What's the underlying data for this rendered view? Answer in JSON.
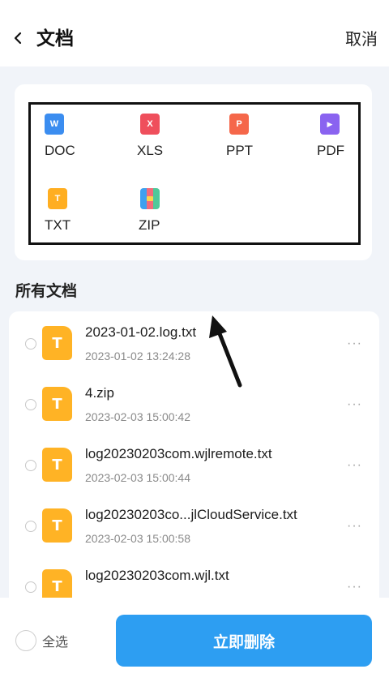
{
  "header": {
    "title": "文档",
    "cancel_label": "取消"
  },
  "categories": [
    {
      "label": "DOC",
      "icon": "word-doc-icon",
      "glyph": "W",
      "color": "#3b8df0"
    },
    {
      "label": "XLS",
      "icon": "excel-xls-icon",
      "glyph": "X",
      "color": "#ef4f5c"
    },
    {
      "label": "PPT",
      "icon": "ppt-icon",
      "glyph": "P",
      "color": "#f5674a"
    },
    {
      "label": "PDF",
      "icon": "pdf-icon",
      "glyph": "▶",
      "color": "#8a63f0"
    },
    {
      "label": "TXT",
      "icon": "txt-icon",
      "glyph": "T",
      "color": "#ffae21"
    },
    {
      "label": "ZIP",
      "icon": "zip-icon",
      "glyph": "",
      "color": "#f36a7a"
    }
  ],
  "section_title": "所有文档",
  "files": [
    {
      "name": "2023-01-02.log.txt",
      "date": "2023-01-02 13:24:28"
    },
    {
      "name": "4.zip",
      "date": "2023-02-03 15:00:42"
    },
    {
      "name": "log20230203com.wjlremote.txt",
      "date": "2023-02-03 15:00:44"
    },
    {
      "name": "log20230203co...jlCloudService.txt",
      "date": "2023-02-03 15:00:58"
    },
    {
      "name": "log20230203com.wjl.txt",
      "date": ""
    }
  ],
  "file_icon_glyph": "T",
  "more_glyph": "···",
  "footer": {
    "select_all_label": "全选",
    "delete_label": "立即删除"
  },
  "colors": {
    "accent": "#2d9ef2",
    "file_icon": "#ffb325",
    "background": "#f1f4f9"
  }
}
